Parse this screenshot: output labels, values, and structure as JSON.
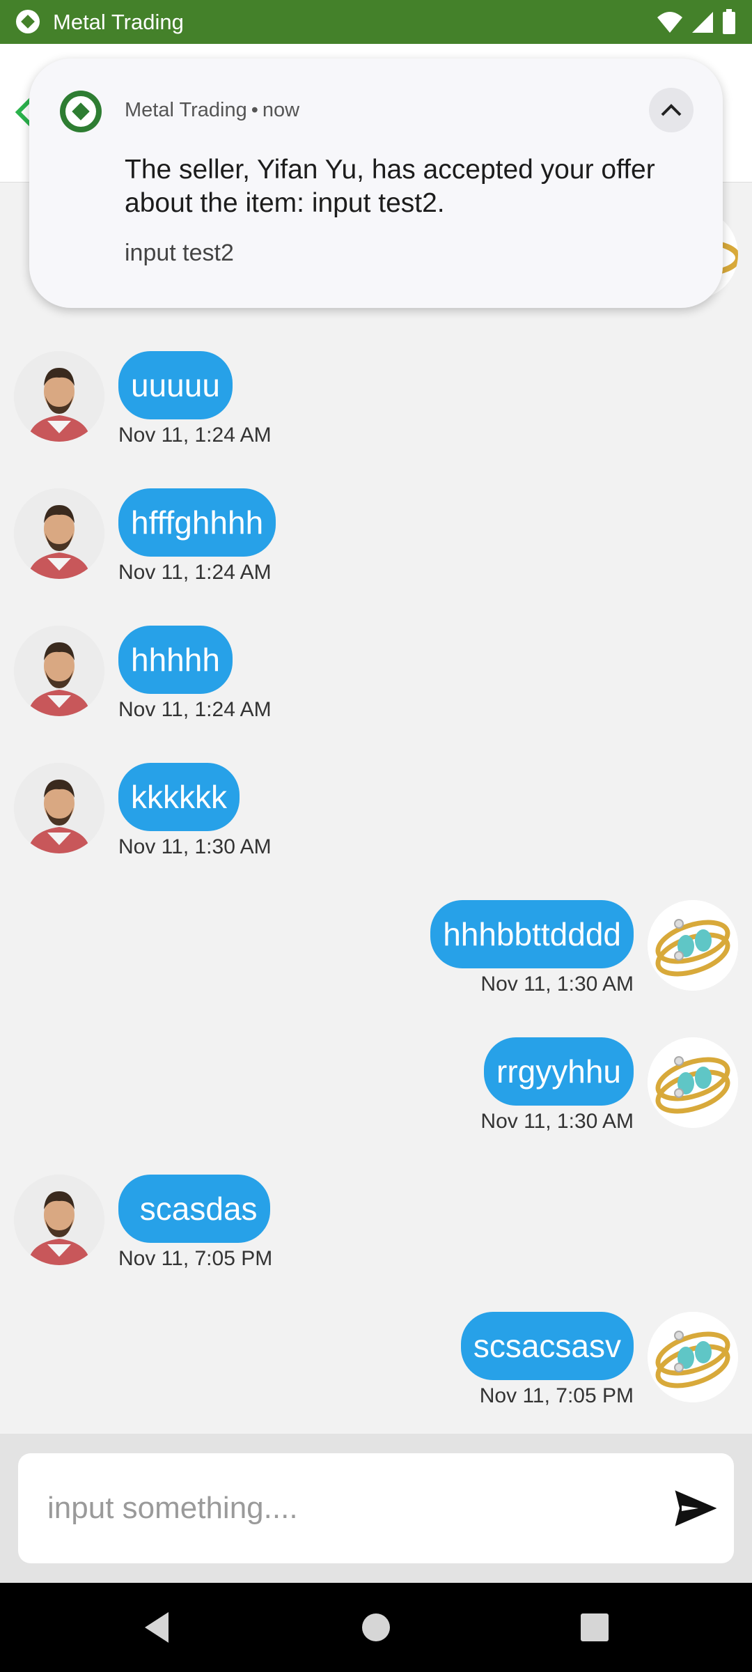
{
  "status_bar": {
    "app_name": "Metal Trading",
    "icons": [
      "wifi-icon",
      "signal-icon",
      "battery-icon"
    ]
  },
  "notification": {
    "app_name": "Metal Trading",
    "separator": "•",
    "time": "now",
    "title": "The seller, Yifan Yu, has accepted your offer about the item: input test2.",
    "text": "input test2"
  },
  "messages": [
    {
      "side": "left",
      "text": "uuuuu",
      "time": "Nov 11, 1:24 AM"
    },
    {
      "side": "left",
      "text": "hfffghhhh",
      "time": "Nov 11, 1:24 AM"
    },
    {
      "side": "left",
      "text": "hhhhh",
      "time": "Nov 11, 1:24 AM"
    },
    {
      "side": "left",
      "text": "kkkkkk",
      "time": "Nov 11, 1:30 AM"
    },
    {
      "side": "right",
      "text": "hhhbbttdddd",
      "time": "Nov 11, 1:30 AM"
    },
    {
      "side": "right",
      "text": "rrgyyhhu",
      "time": "Nov 11, 1:30 AM"
    },
    {
      "side": "left",
      "text": " scasdas",
      "time": "Nov 11, 7:05 PM"
    },
    {
      "side": "right",
      "text": "scsacsasv",
      "time": "Nov 11, 7:05 PM"
    }
  ],
  "input": {
    "placeholder": "input something...."
  },
  "colors": {
    "status_bar": "#44812a",
    "bubble": "#27a1e8",
    "accent_green": "#2e7d32"
  }
}
